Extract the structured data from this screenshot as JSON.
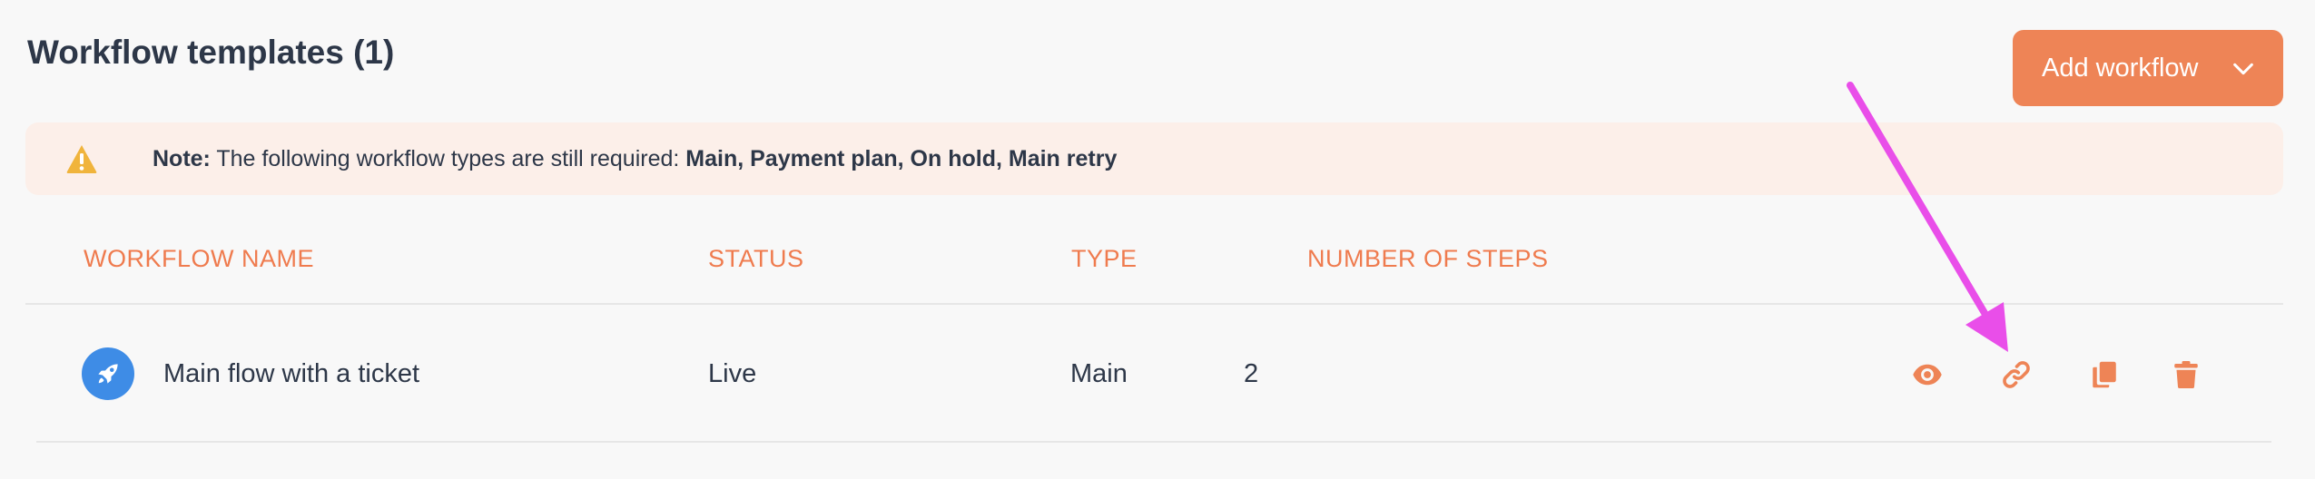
{
  "header": {
    "title": "Workflow templates (1)",
    "add_button_label": "Add workflow"
  },
  "notice": {
    "icon": "warning-icon",
    "prefix": "Note:",
    "message": " The following workflow types are still required: ",
    "required_types": "Main, Payment plan, On hold, Main retry"
  },
  "table": {
    "columns": [
      "WORKFLOW NAME",
      "STATUS",
      "TYPE",
      "NUMBER OF STEPS"
    ],
    "rows": [
      {
        "icon": "rocket-icon",
        "name": "Main flow with a ticket",
        "status": "Live",
        "type": "Main",
        "steps": "2",
        "actions": [
          "eye-icon",
          "link-icon",
          "copy-icon",
          "trash-icon"
        ]
      }
    ]
  },
  "colors": {
    "accent": "#ee8456",
    "header_text": "#ef7b4e",
    "notice_bg": "#fcefe9",
    "warning": "#f0b43c",
    "avatar": "#3e8ce6",
    "annotation_arrow": "#e94ee9"
  }
}
